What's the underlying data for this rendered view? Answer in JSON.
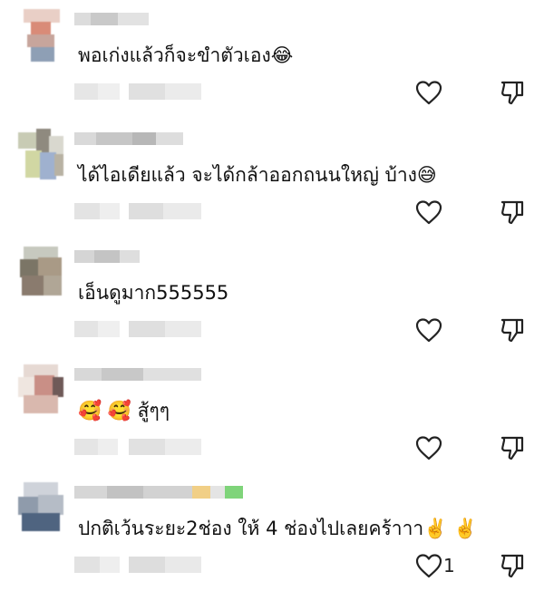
{
  "icons": {
    "like": "heart-outline-icon",
    "dislike": "thumbs-down-outline-icon"
  },
  "colors": {
    "text": "#111111",
    "icon_stroke": "#222222",
    "blur_gray": "#d7d7d7"
  },
  "comments": [
    {
      "text": "พอเก่งแล้วก็จะขำตัวเอง😂",
      "like_count": ""
    },
    {
      "text": "ได้ไอเดียแล้ว  จะได้กล้าออกถนนใหญ่ บ้าง😅",
      "like_count": ""
    },
    {
      "text": "เอ็นดูมาก555555",
      "like_count": ""
    },
    {
      "text": "🥰 🥰 สู้ๆๆ",
      "like_count": ""
    },
    {
      "text": "ปกติเว้นระยะ2ช่อง ให้ 4 ช่องไปเลยคร้าาา✌️ ✌️",
      "like_count": "1"
    }
  ]
}
